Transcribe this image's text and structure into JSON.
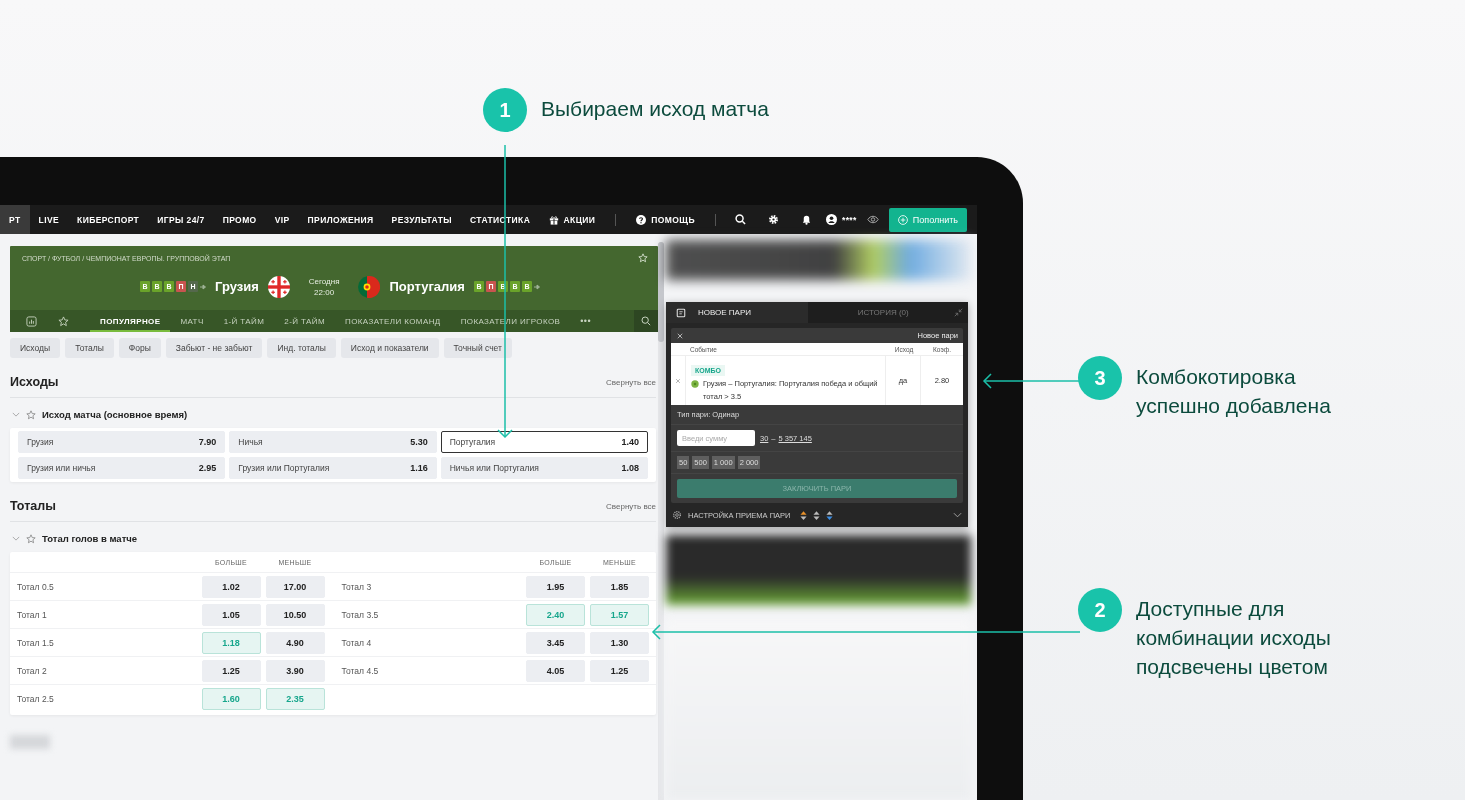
{
  "annotations": [
    {
      "number": "1",
      "text": "Выбираем исход матча"
    },
    {
      "number": "3",
      "text": "Комбокотировка\nуспешно добавлена"
    },
    {
      "number": "2",
      "text": "Доступные для\nкомбинации исходы\nподсвечены цветом"
    }
  ],
  "nav": {
    "items": [
      {
        "label": "РТ",
        "selected": true
      },
      {
        "label": "LIVE",
        "selected": false
      },
      {
        "label": "КИБЕРСПОРТ",
        "selected": false
      },
      {
        "label": "ИГРЫ 24/7",
        "selected": false
      },
      {
        "label": "ПРОМО",
        "selected": false
      },
      {
        "label": "VIP",
        "selected": false
      },
      {
        "label": "ПРИЛОЖЕНИЯ",
        "selected": false
      },
      {
        "label": "РЕЗУЛЬТАТЫ",
        "selected": false
      },
      {
        "label": "СТАТИСТИКА",
        "selected": false
      }
    ],
    "promo": "АКЦИИ",
    "help": "ПОМОЩЬ",
    "balance": "****",
    "deposit": "Пополнить"
  },
  "match": {
    "breadcrumb": "СПОРТ / ФУТБОЛ / ЧЕМПИОНАТ ЕВРОПЫ. ГРУППОВОЙ ЭТАП",
    "home": {
      "name": "Грузия",
      "form": [
        {
          "label": "В",
          "color": "#6aa32a"
        },
        {
          "label": "В",
          "color": "#6aa32a"
        },
        {
          "label": "В",
          "color": "#6aa32a"
        },
        {
          "label": "П",
          "color": "#c8544f"
        },
        {
          "label": "Н",
          "color": "#55684c"
        }
      ]
    },
    "date": "Сегодня",
    "time": "22:00",
    "away": {
      "name": "Португалия",
      "form": [
        {
          "label": "В",
          "color": "#6aa32a"
        },
        {
          "label": "П",
          "color": "#c8544f"
        },
        {
          "label": "В",
          "color": "#6aa32a"
        },
        {
          "label": "В",
          "color": "#6aa32a"
        },
        {
          "label": "В",
          "color": "#6aa32a"
        }
      ]
    },
    "tabs": [
      {
        "label": "ПОПУЛЯРНОЕ",
        "selected": true
      },
      {
        "label": "МАТЧ",
        "selected": false
      },
      {
        "label": "1-Й ТАЙМ",
        "selected": false
      },
      {
        "label": "2-Й ТАЙМ",
        "selected": false
      },
      {
        "label": "ПОКАЗАТЕЛИ КОМАНД",
        "selected": false
      },
      {
        "label": "ПОКАЗАТЕЛИ ИГРОКОВ",
        "selected": false
      }
    ],
    "more": "•••"
  },
  "chips": [
    "Исходы",
    "Тоталы",
    "Форы",
    "Забьют - не забьют",
    "Инд. тоталы",
    "Исход и показатели",
    "Точный счет"
  ],
  "sections": [
    {
      "kind": "outcomes",
      "title": "Исходы",
      "collapse": "Свернуть все",
      "market": "Исход матча (основное время)",
      "outcomes": [
        {
          "label": "Грузия",
          "odds": "7.90",
          "selected": false
        },
        {
          "label": "Ничья",
          "odds": "5.30",
          "selected": false
        },
        {
          "label": "Португалия",
          "odds": "1.40",
          "selected": true
        },
        {
          "label": "Грузия или ничья",
          "odds": "2.95",
          "selected": false
        },
        {
          "label": "Грузия или Португалия",
          "odds": "1.16",
          "selected": false
        },
        {
          "label": "Ничья или Португалия",
          "odds": "1.08",
          "selected": false
        }
      ]
    },
    {
      "kind": "totals",
      "title": "Тоталы",
      "collapse": "Свернуть все",
      "market": "Тотал голов в матче",
      "column_groups": [
        [
          "БОЛЬШЕ",
          "МЕНЬШЕ"
        ],
        [
          "БОЛЬШЕ",
          "МЕНЬШЕ"
        ]
      ],
      "rows": [
        {
          "cells": [
            {
              "label": "Тотал 0.5",
              "odds": [
                {
                  "value": "1.02",
                  "highlighted": false
                },
                {
                  "value": "17.00",
                  "highlighted": false
                }
              ]
            },
            {
              "label": "Тотал 3",
              "odds": [
                {
                  "value": "1.95",
                  "highlighted": false
                },
                {
                  "value": "1.85",
                  "highlighted": false
                }
              ]
            }
          ]
        },
        {
          "cells": [
            {
              "label": "Тотал 1",
              "odds": [
                {
                  "value": "1.05",
                  "highlighted": false
                },
                {
                  "value": "10.50",
                  "highlighted": false
                }
              ]
            },
            {
              "label": "Тотал 3.5",
              "odds": [
                {
                  "value": "2.40",
                  "highlighted": true
                },
                {
                  "value": "1.57",
                  "highlighted": true
                }
              ]
            }
          ]
        },
        {
          "cells": [
            {
              "label": "Тотал 1.5",
              "odds": [
                {
                  "value": "1.18",
                  "highlighted": true
                },
                {
                  "value": "4.90",
                  "highlighted": false
                }
              ]
            },
            {
              "label": "Тотал 4",
              "odds": [
                {
                  "value": "3.45",
                  "highlighted": false
                },
                {
                  "value": "1.30",
                  "highlighted": false
                }
              ]
            }
          ]
        },
        {
          "cells": [
            {
              "label": "Тотал 2",
              "odds": [
                {
                  "value": "1.25",
                  "highlighted": false
                },
                {
                  "value": "3.90",
                  "highlighted": false
                }
              ]
            },
            {
              "label": "Тотал 4.5",
              "odds": [
                {
                  "value": "4.05",
                  "highlighted": false
                },
                {
                  "value": "1.25",
                  "highlighted": false
                }
              ]
            }
          ]
        },
        {
          "cells": [
            {
              "label": "Тотал 2.5",
              "odds": [
                {
                  "value": "1.60",
                  "highlighted": true
                },
                {
                  "value": "2.35",
                  "highlighted": true
                }
              ]
            }
          ]
        }
      ]
    }
  ],
  "betslip": {
    "tabs": [
      {
        "label": "НОВОЕ ПАРИ",
        "selected": true
      },
      {
        "label": "ИСТОРИЯ (0)",
        "selected": false
      }
    ],
    "title": "Новое пари",
    "columns": [
      "Событие",
      "Исход",
      "Коэф."
    ],
    "bet": {
      "tag": "КОМБО",
      "event": "Грузия – Португалия: Португалия победа и общий тотал > 3.5",
      "outcome": "да",
      "odds": "2.80"
    },
    "bet_type": "Тип пари: Одинар",
    "amount_placeholder": "Введи сумму",
    "min": "30",
    "dash": "–",
    "max": "5 357 145",
    "quick_amounts": [
      "50",
      "500",
      "1 000",
      "2 000"
    ],
    "submit": {
      "label": "ЗАКЛЮЧИТЬ ПАРИ",
      "disabled": true
    },
    "settings": "НАСТРОЙКА ПРИЕМА ПАРИ"
  }
}
